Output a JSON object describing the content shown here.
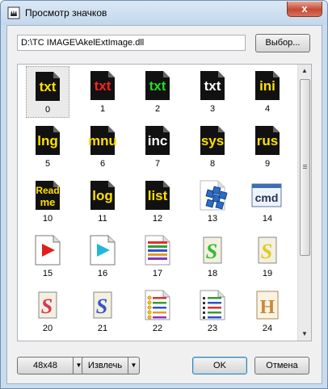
{
  "window": {
    "title": "Просмотр значков",
    "close_label": "x"
  },
  "path": {
    "value": "D:\\TC IMAGE\\AkelExtImage.dll",
    "browse_label": "Выбор..."
  },
  "icons": [
    {
      "index": "0",
      "kind": "text",
      "text": "txt",
      "color": "#ffe000"
    },
    {
      "index": "1",
      "kind": "text",
      "text": "txt",
      "color": "#ff2020"
    },
    {
      "index": "2",
      "kind": "text",
      "text": "txt",
      "color": "#22dd22"
    },
    {
      "index": "3",
      "kind": "text",
      "text": "txt",
      "color": "#ffffff"
    },
    {
      "index": "4",
      "kind": "text",
      "text": "ini",
      "color": "#ffe000"
    },
    {
      "index": "5",
      "kind": "text",
      "text": "lng",
      "color": "#ffe000"
    },
    {
      "index": "6",
      "kind": "text",
      "text": "mnu",
      "color": "#ffe000"
    },
    {
      "index": "7",
      "kind": "text",
      "text": "inc",
      "color": "#ffffff"
    },
    {
      "index": "8",
      "kind": "text",
      "text": "sys",
      "color": "#ffe000"
    },
    {
      "index": "9",
      "kind": "text",
      "text": "rus",
      "color": "#ffe000"
    },
    {
      "index": "10",
      "kind": "text2",
      "text": "Read",
      "text2": "me",
      "color": "#ffe000"
    },
    {
      "index": "11",
      "kind": "text",
      "text": "log",
      "color": "#ffe000"
    },
    {
      "index": "12",
      "kind": "text",
      "text": "list",
      "color": "#ffe000"
    },
    {
      "index": "13",
      "kind": "cubes"
    },
    {
      "index": "14",
      "kind": "cmd",
      "text": "cmd"
    },
    {
      "index": "15",
      "kind": "play",
      "color": "#e02020"
    },
    {
      "index": "16",
      "kind": "play",
      "color": "#20b8d8"
    },
    {
      "index": "17",
      "kind": "stripes"
    },
    {
      "index": "18",
      "kind": "scroll",
      "letter": "S",
      "color": "#33bb33"
    },
    {
      "index": "19",
      "kind": "scroll",
      "letter": "S",
      "color": "#ddcc22"
    },
    {
      "index": "20",
      "kind": "scroll",
      "letter": "S",
      "color": "#dd3355"
    },
    {
      "index": "21",
      "kind": "scroll",
      "letter": "S",
      "color": "#3355cc"
    },
    {
      "index": "22",
      "kind": "list"
    },
    {
      "index": "23",
      "kind": "list2"
    },
    {
      "index": "24",
      "kind": "hbook",
      "letter": "H",
      "color": "#c8893a"
    }
  ],
  "selected_index": "0",
  "bottom": {
    "size_label": "48x48",
    "extract_label": "Извлечь",
    "ok_label": "OK",
    "cancel_label": "Отмена"
  }
}
